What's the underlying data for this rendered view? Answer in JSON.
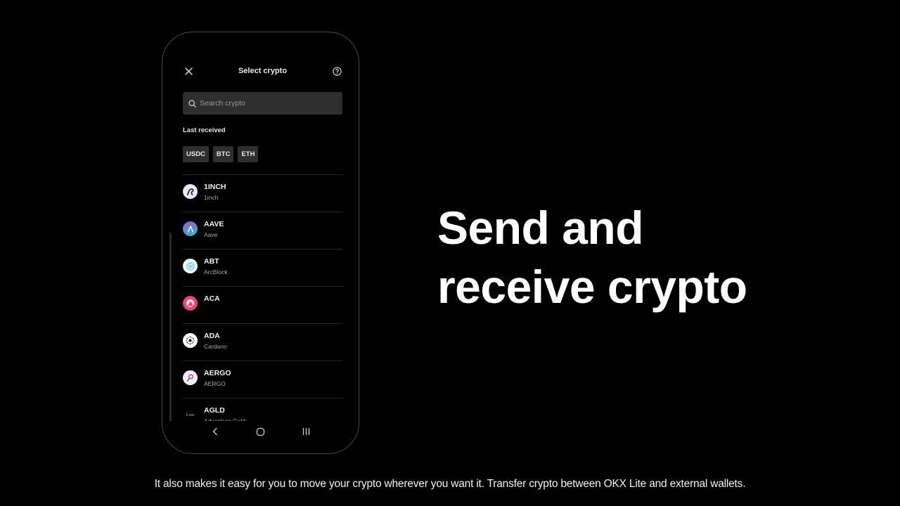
{
  "phone_screen": {
    "header": {
      "title": "Select crypto",
      "close_icon": "close-icon",
      "help_icon": "help-circle-icon"
    },
    "search": {
      "placeholder": "Search crypto",
      "value": "",
      "icon": "search-icon"
    },
    "last_received": {
      "label": "Last received",
      "chips": [
        "USDC",
        "BTC",
        "ETH"
      ]
    },
    "crypto_list": [
      {
        "symbol": "1INCH",
        "name": "1inch",
        "icon": "1inch-logo-icon",
        "color": "#e8e8f0"
      },
      {
        "symbol": "AAVE",
        "name": "Aave",
        "icon": "aave-logo-icon",
        "color": "#6a5fc4"
      },
      {
        "symbol": "ABT",
        "name": "ArcBlock",
        "icon": "arcblock-logo-icon",
        "color": "#e8f4f6"
      },
      {
        "symbol": "ACA",
        "name": "",
        "icon": "acala-logo-icon",
        "color": "#e0457b"
      },
      {
        "symbol": "ADA",
        "name": "Cardano",
        "icon": "cardano-logo-icon",
        "color": "#ffffff"
      },
      {
        "symbol": "AERGO",
        "name": "AERGO",
        "icon": "aergo-logo-icon",
        "color": "#f2f2f2"
      },
      {
        "symbol": "AGLD",
        "name": "Adventure Gold",
        "icon": "loot-logo-icon",
        "icon_text": "Loot",
        "color": "#000000"
      }
    ],
    "nav_bar": {
      "back_icon": "back-chevron-icon",
      "home_icon": "home-icon",
      "recents_icon": "recent-apps-icon"
    }
  },
  "headline": {
    "line1": "Send and",
    "line2": "receive crypto"
  },
  "caption": "It also makes it easy for you to move your crypto wherever you want it. Transfer crypto between OKX Lite and external wallets."
}
